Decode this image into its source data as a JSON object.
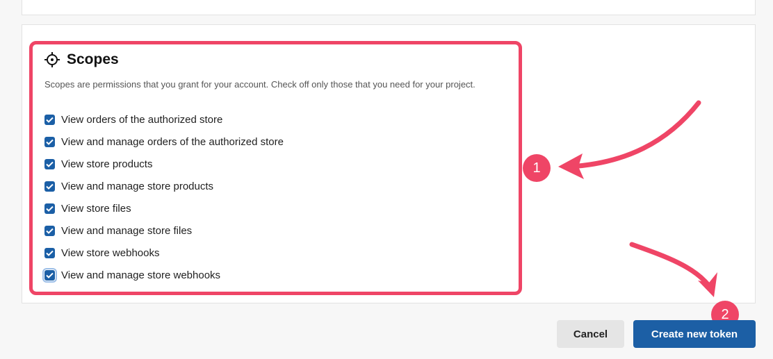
{
  "scopes": {
    "icon": "crosshair-icon",
    "title": "Scopes",
    "description": "Scopes are permissions that you grant for your account. Check off only those that you need for your project.",
    "items": [
      {
        "label": "View orders of the authorized store",
        "checked": true
      },
      {
        "label": "View and manage orders of the authorized store",
        "checked": true
      },
      {
        "label": "View store products",
        "checked": true
      },
      {
        "label": "View and manage store products",
        "checked": true
      },
      {
        "label": "View store files",
        "checked": true
      },
      {
        "label": "View and manage store files",
        "checked": true
      },
      {
        "label": "View store webhooks",
        "checked": true
      },
      {
        "label": "View and manage store webhooks",
        "checked": true
      }
    ]
  },
  "annotations": {
    "badge_1": "1",
    "badge_2": "2",
    "color": "#ef4566"
  },
  "actions": {
    "cancel_label": "Cancel",
    "create_label": "Create new token"
  },
  "colors": {
    "primary": "#1c5fa5",
    "checkbox": "#1b5fa6"
  }
}
